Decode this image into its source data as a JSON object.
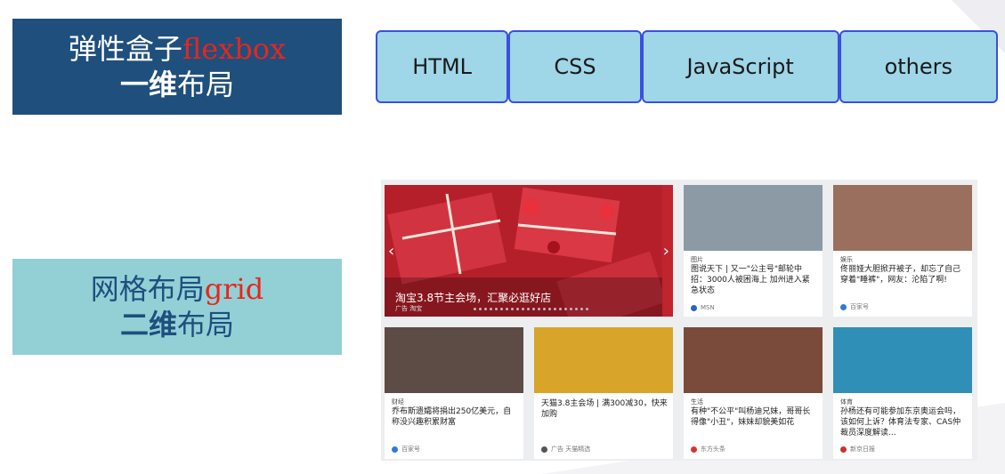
{
  "flex_label": {
    "main": "弹性盒子",
    "accent": "flexbox",
    "line2_bold": "一维",
    "line2_rest": "布局"
  },
  "grid_label": {
    "main": "网格布局",
    "accent": "grid",
    "line2_bold": "二维",
    "line2_rest": "布局"
  },
  "flex_items": [
    {
      "label": "HTML",
      "grow": 1
    },
    {
      "label": "CSS",
      "grow": 1
    },
    {
      "label": "JavaScript",
      "grow": 1.5
    },
    {
      "label": "others",
      "grow": 1.2
    }
  ],
  "grid_demo": {
    "big_card": {
      "caption": "淘宝3.8节主会场，汇聚必逛好店",
      "sub": "广告  淘宝"
    },
    "cards": [
      {
        "tag": "图片",
        "title": "图说天下 | 又一\"公主号\"邮轮中招：3000人被困海上 加州进入紧急状态",
        "source": "MSN",
        "img_color": "#8c9aa5",
        "src_color": "#2b63c6"
      },
      {
        "tag": "娱乐",
        "title": "佟丽娅大胆掀开被子，却忘了自己穿着\"睡裤\"，网友：沦陷了啊!",
        "source": "百家号",
        "img_color": "#9a6f5d",
        "src_color": "#2f7bd6"
      },
      {
        "tag": "财经",
        "title": "乔布斯遗孀将捐出250亿美元，自称没兴趣积累财富",
        "source": "百家号",
        "img_color": "#5d4b46",
        "src_color": "#2f7bd6"
      },
      {
        "tag": "",
        "title": "天猫3.8主会场 | 满300减30，快来加购",
        "source": "广告  天猫精选",
        "img_color": "#d8a52a",
        "src_color": "#555555"
      },
      {
        "tag": "生活",
        "title": "有种\"不公平\"叫杨迪兄妹，哥哥长得像\"小丑\"，妹妹却貌美如花",
        "source": "东方头条",
        "img_color": "#7a4a3a",
        "src_color": "#d8342b"
      },
      {
        "tag": "体育",
        "title": "孙杨还有可能参加东京奥运会吗，该如何上诉？体育法专家、CAS仲裁员深度解读...",
        "source": "新京日报",
        "img_color": "#2f8fb7",
        "src_color": "#c8342b"
      }
    ]
  }
}
